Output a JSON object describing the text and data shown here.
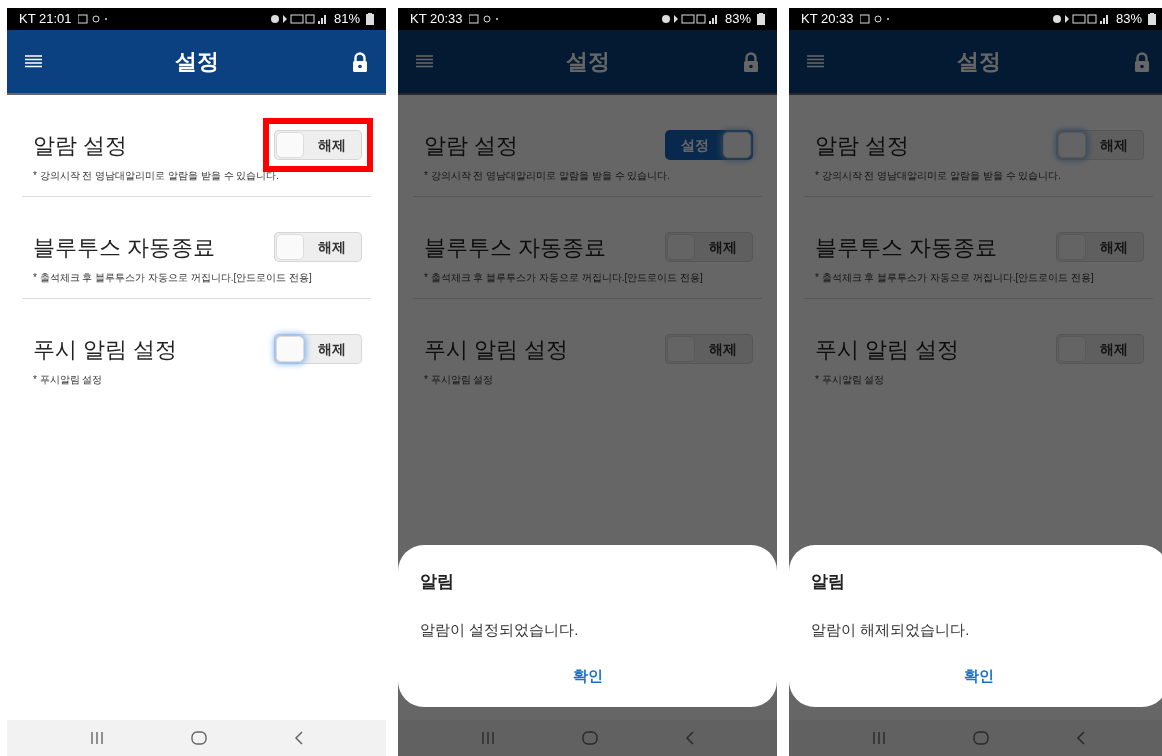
{
  "screens": [
    {
      "status_bar": {
        "time": "KT 21:01",
        "battery": "81%"
      },
      "dimmed": false,
      "header": {
        "title": "설정"
      },
      "settings": [
        {
          "title": "알람 설정",
          "note": "* 강의시작 전 영남대알리미로 알람을 받을 수 있습니다.",
          "toggle": {
            "label": "해제",
            "on": false,
            "focused": false
          },
          "highlighted": true
        },
        {
          "title": "블루투스 자동종료",
          "note": "* 출석체크 후 블루투스가 자동으로 꺼집니다.[안드로이드 전용]",
          "toggle": {
            "label": "해제",
            "on": false,
            "focused": false
          },
          "highlighted": false
        },
        {
          "title": "푸시 알림 설정",
          "note": "* 푸시알림 설정",
          "toggle": {
            "label": "해제",
            "on": false,
            "focused": true
          },
          "highlighted": false
        }
      ]
    },
    {
      "status_bar": {
        "time": "KT 20:33",
        "battery": "83%"
      },
      "dimmed": true,
      "header": {
        "title": "설정"
      },
      "settings": [
        {
          "title": "알람 설정",
          "note": "* 강의시작 전 영남대알리미로 알람을 받을 수 있습니다.",
          "toggle": {
            "label": "설정",
            "on": true,
            "focused": true
          },
          "highlighted": false
        },
        {
          "title": "블루투스 자동종료",
          "note": "* 출석체크 후 블루투스가 자동으로 꺼집니다.[안드로이드 전용]",
          "toggle": {
            "label": "해제",
            "on": false,
            "focused": false
          },
          "highlighted": false
        },
        {
          "title": "푸시 알림 설정",
          "note": "* 푸시알림 설정",
          "toggle": {
            "label": "해제",
            "on": false,
            "focused": false
          },
          "highlighted": false
        }
      ],
      "dialog": {
        "title": "알림",
        "message": "알람이 설정되었습니다.",
        "button": "확인"
      }
    },
    {
      "status_bar": {
        "time": "KT 20:33",
        "battery": "83%"
      },
      "dimmed": true,
      "header": {
        "title": "설정"
      },
      "settings": [
        {
          "title": "알람 설정",
          "note": "* 강의시작 전 영남대알리미로 알람을 받을 수 있습니다.",
          "toggle": {
            "label": "해제",
            "on": false,
            "focused": true
          },
          "highlighted": false
        },
        {
          "title": "블루투스 자동종료",
          "note": "* 출석체크 후 블루투스가 자동으로 꺼집니다.[안드로이드 전용]",
          "toggle": {
            "label": "해제",
            "on": false,
            "focused": false
          },
          "highlighted": false
        },
        {
          "title": "푸시 알림 설정",
          "note": "* 푸시알림 설정",
          "toggle": {
            "label": "해제",
            "on": false,
            "focused": false
          },
          "highlighted": false
        }
      ],
      "dialog": {
        "title": "알림",
        "message": "알람이 해제되었습니다.",
        "button": "확인"
      }
    }
  ]
}
